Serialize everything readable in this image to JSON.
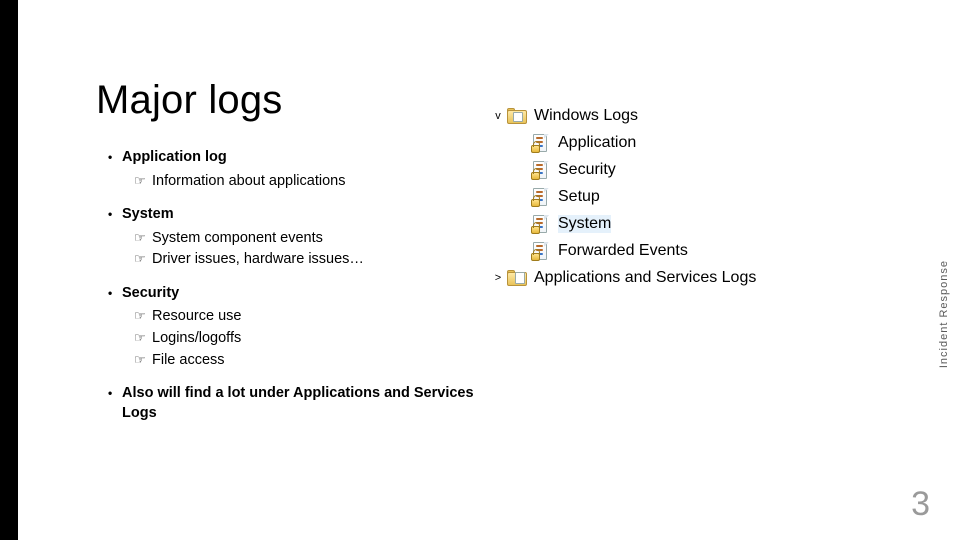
{
  "slide": {
    "title": "Major logs",
    "bullets": [
      {
        "title": "Application log",
        "items": [
          "Information about applications"
        ]
      },
      {
        "title": "System",
        "items": [
          "System component events",
          "Driver issues, hardware issues…"
        ]
      },
      {
        "title": "Security",
        "items": [
          "Resource use",
          "Logins/logoffs",
          "File access"
        ]
      },
      {
        "title": "Also will find a lot under Applications and Services Logs",
        "items": []
      }
    ],
    "sidenote": "Incident Response",
    "page_number": "3"
  },
  "tree": {
    "root": {
      "label": "Windows Logs",
      "caret": "v"
    },
    "items": [
      {
        "label": "Application",
        "selected": false
      },
      {
        "label": "Security",
        "selected": false
      },
      {
        "label": "Setup",
        "selected": false
      },
      {
        "label": "System",
        "selected": true
      },
      {
        "label": "Forwarded Events",
        "selected": false
      }
    ],
    "services": {
      "label": "Applications and Services Logs",
      "caret": ">"
    }
  }
}
